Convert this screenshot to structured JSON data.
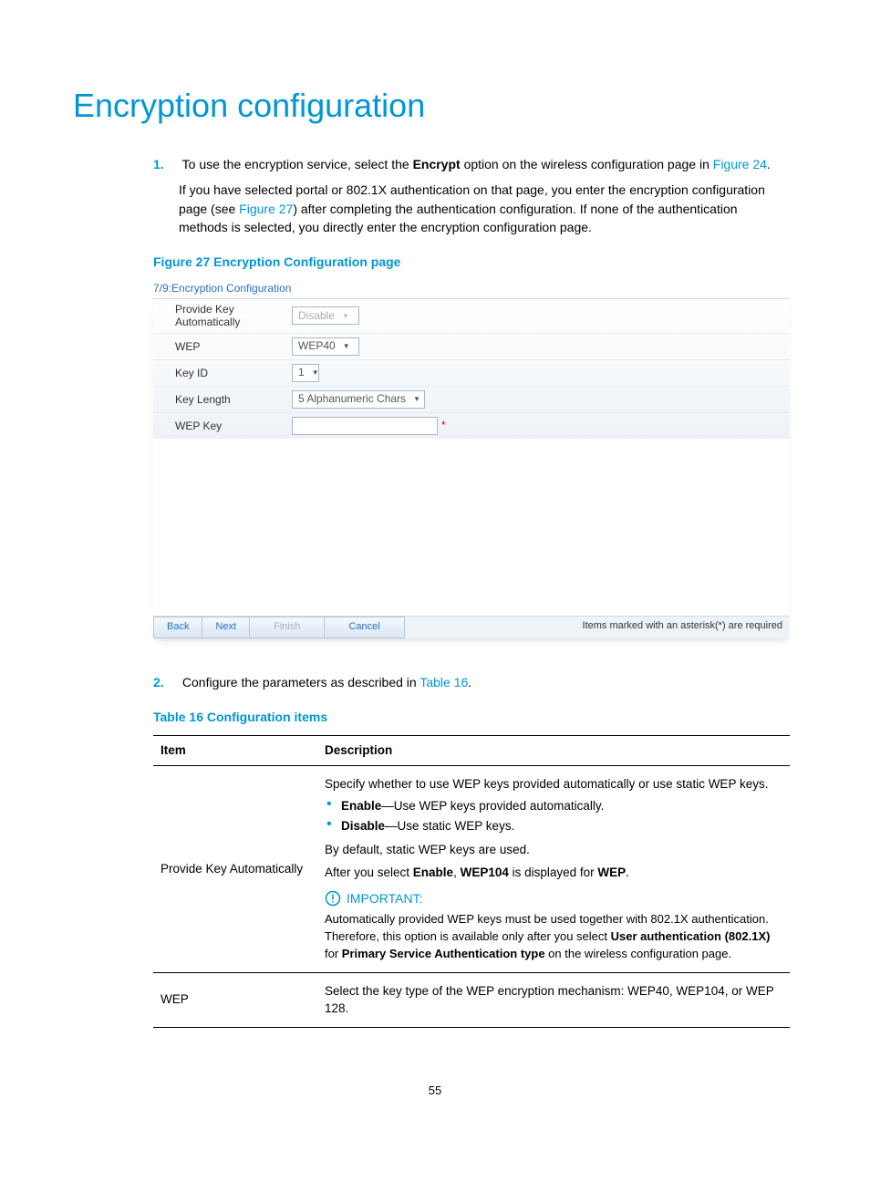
{
  "title": "Encryption configuration",
  "step1_num": "1.",
  "step1_l1a": "To use the encryption service, select the ",
  "step1_l1b": "Encrypt",
  "step1_l1c": " option on the wireless configuration page in ",
  "step1_link1": "Figure 24",
  "step1_l1d": ".",
  "step1_p2a": "If you have selected portal or 802.1X authentication on that page, you enter the encryption configuration page (see ",
  "step1_link2": "Figure 27",
  "step1_p2b": ") after completing the authentication configuration. If none of the authentication methods is selected, you directly enter the encryption configuration page.",
  "fig_caption": "Figure 27 Encryption Configuration page",
  "fig": {
    "header": "7/9:Encryption Configuration",
    "rows": {
      "r1_label": "Provide Key Automatically",
      "r1_value": "Disable",
      "r2_label": "WEP",
      "r2_value": "WEP40",
      "r3_label": "Key ID",
      "r3_value": "1",
      "r4_label": "Key Length",
      "r4_value": "5 Alphanumeric Chars",
      "r5_label": "WEP Key"
    },
    "buttons": {
      "back": "Back",
      "next": "Next",
      "finish": "Finish",
      "cancel": "Cancel"
    },
    "note": "Items marked with an asterisk(*) are required"
  },
  "step2_num": "2.",
  "step2_a": "Configure the parameters as described in ",
  "step2_link": "Table 16",
  "step2_b": ".",
  "tbl_caption": "Table 16 Configuration items",
  "tbl": {
    "h1": "Item",
    "h2": "Description",
    "row1_item": "Provide Key Automatically",
    "row1_p1": "Specify whether to use WEP keys provided automatically or use static WEP keys.",
    "row1_b1a": "Enable",
    "row1_b1b": "—Use WEP keys provided automatically.",
    "row1_b2a": "Disable",
    "row1_b2b": "—Use static WEP keys.",
    "row1_p2": "By default, static WEP keys are used.",
    "row1_p3a": "After you select ",
    "row1_p3b": "Enable",
    "row1_p3c": ", ",
    "row1_p3d": "WEP104",
    "row1_p3e": " is displayed for ",
    "row1_p3f": "WEP",
    "row1_p3g": ".",
    "row1_imp_label": "IMPORTANT:",
    "row1_imp_a": "Automatically provided WEP keys must be used together with 802.1X authentication. Therefore, this option is available only after you select ",
    "row1_imp_b": "User authentication (802.1X)",
    "row1_imp_c": " for ",
    "row1_imp_d": "Primary Service Authentication type",
    "row1_imp_e": " on the wireless configuration page.",
    "row2_item": "WEP",
    "row2_desc": "Select the key type of the WEP encryption mechanism: WEP40, WEP104, or WEP 128."
  },
  "page_number": "55"
}
